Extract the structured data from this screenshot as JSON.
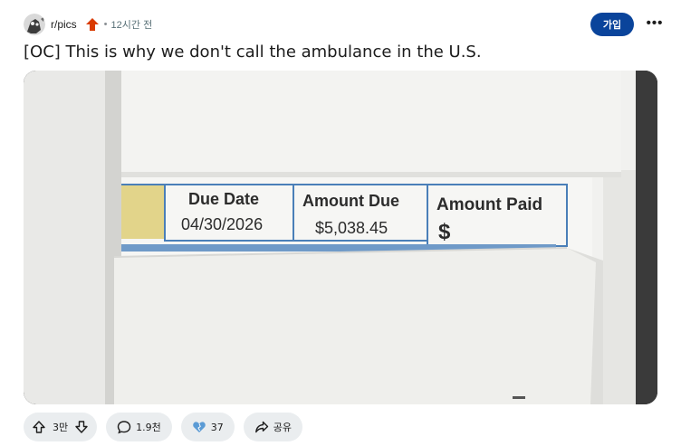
{
  "post": {
    "subreddit": "r/pics",
    "separator": "•",
    "time_ago": "12시간 전",
    "join_label": "가입",
    "more_label": "•••",
    "title": "[OC] This is why we don't call the ambulance in the U.S."
  },
  "image": {
    "col_due_date": "Due Date",
    "due_date": "04/30/2026",
    "col_amount_due": "Amount Due",
    "amount_due": "$5,038.45",
    "col_amount_paid": "Amount Paid",
    "amount_paid_symbol": "$"
  },
  "actions": {
    "votes": "3만",
    "comments": "1.9천",
    "awards": "37",
    "share": "공유"
  },
  "icons": {
    "avatar": "subreddit-avatar",
    "trending": "trending-up-arrow-icon",
    "upvote": "upvote-arrow-icon",
    "downvote": "downvote-arrow-icon",
    "comment": "comment-bubble-icon",
    "award": "award-heart-icon",
    "share": "share-arrow-icon"
  },
  "colors": {
    "join_button": "#0a449b",
    "trending_icon": "#d93a00",
    "pill_background": "#eaedef",
    "award_icon": "#5b9bd5",
    "table_border": "#4a7fb8"
  }
}
